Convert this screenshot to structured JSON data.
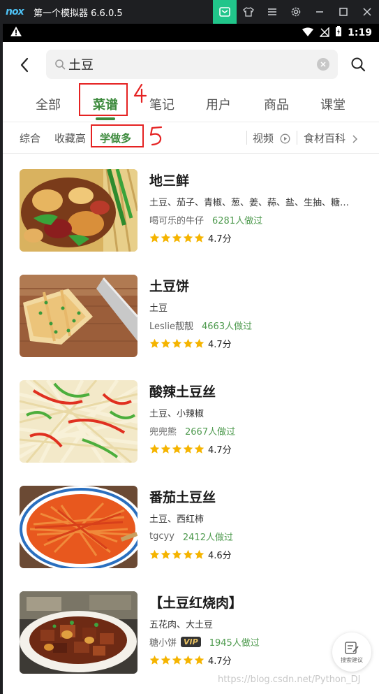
{
  "emulator": {
    "logo": "nox",
    "title": "第一个模拟器 6.6.0.5",
    "buttons": [
      "mail-icon",
      "shirt-icon",
      "menu-icon",
      "gear-icon",
      "minimize-icon",
      "maximize-icon",
      "close-icon"
    ]
  },
  "status_bar": {
    "time": "1:19"
  },
  "search": {
    "query": "土豆"
  },
  "tabs": [
    {
      "label": "全部"
    },
    {
      "label": "菜谱",
      "active": true
    },
    {
      "label": "笔记"
    },
    {
      "label": "用户"
    },
    {
      "label": "商品"
    },
    {
      "label": "课堂"
    }
  ],
  "filters": {
    "sort": [
      {
        "label": "综合"
      },
      {
        "label": "收藏高"
      },
      {
        "label": "学做多",
        "active": true
      }
    ],
    "video_label": "视频",
    "ingredient_wiki_label": "食材百科"
  },
  "annotations": [
    "4",
    "5"
  ],
  "recipes": [
    {
      "title": "地三鲜",
      "ingredients": "土豆、茄子、青椒、葱、姜、蒜、盐、生抽、糖、醋、淀粉",
      "author": "喝可乐的牛仔",
      "vip": false,
      "made": "6281人做过",
      "rating": "4.7分",
      "stars": 5
    },
    {
      "title": "土豆饼",
      "ingredients": "土豆",
      "author": "Leslie靓靓",
      "vip": false,
      "made": "4663人做过",
      "rating": "4.7分",
      "stars": 5
    },
    {
      "title": "酸辣土豆丝",
      "ingredients": "土豆、小辣椒",
      "author": "兜兜熊",
      "vip": false,
      "made": "2667人做过",
      "rating": "4.7分",
      "stars": 5
    },
    {
      "title": "番茄土豆丝",
      "ingredients": "土豆、西红柿",
      "author": "tgcyy",
      "vip": false,
      "made": "2412人做过",
      "rating": "4.6分",
      "stars": 5
    },
    {
      "title": "【土豆红烧肉】",
      "ingredients": "五花肉、大土豆",
      "author": "糖小饼",
      "vip": true,
      "vip_label": "VIP",
      "made": "1945人做过",
      "rating": "4.7分",
      "stars": 5
    }
  ],
  "fab": {
    "label": "搜索建议"
  },
  "watermark": "https://blog.csdn.net/Python_DJ",
  "colors": {
    "accent_green": "#3c8a3c",
    "made_green": "#4e9a4e",
    "star_yellow": "#f5b400",
    "annotation_red": "#e52222",
    "emulator_active": "#21c58a"
  }
}
